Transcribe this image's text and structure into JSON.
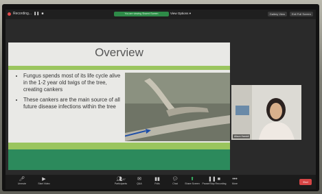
{
  "topbar": {
    "recording_label": "Recording...",
    "pill_text": "You are viewing Shared Screen",
    "view_options": "View Options",
    "gallery_view": "Gallery View",
    "exit_fullscreen": "Exit Full Screen"
  },
  "slide": {
    "title": "Overview",
    "bullets": [
      "Fungus spends most of its life cycle alive in the 1-2 year old twigs of the tree, creating cankers",
      "These cankers are the main source of all future disease infections within the tree"
    ]
  },
  "participant": {
    "name": "Alison Hamidi"
  },
  "toolbar": {
    "unmute": "Unmute",
    "start_video": "Start Video",
    "participants": "Participants",
    "participants_count": "47",
    "qa": "Q&A",
    "polls": "Polls",
    "chat": "Chat",
    "share_screen": "Share Screen",
    "pause_recording": "Pause/Stop Recording",
    "more": "More",
    "end": "End"
  },
  "colors": {
    "slide_green_light": "#9ac55e",
    "slide_green_dark": "#2c8a5c",
    "recording_red": "#e34b4b",
    "share_green": "#3bc16a",
    "end_red": "#d64545"
  }
}
